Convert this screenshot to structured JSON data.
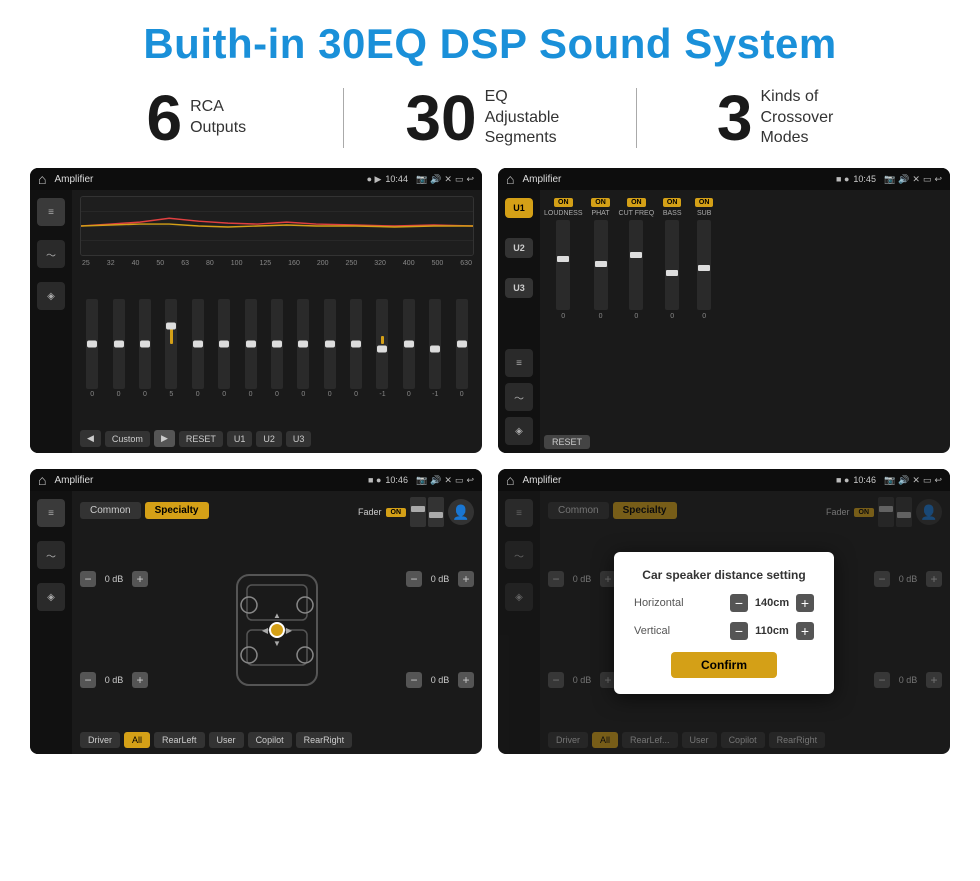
{
  "header": {
    "title": "Buith-in 30EQ DSP Sound System"
  },
  "stats": [
    {
      "number": "6",
      "text_line1": "RCA",
      "text_line2": "Outputs"
    },
    {
      "number": "30",
      "text_line1": "EQ Adjustable",
      "text_line2": "Segments"
    },
    {
      "number": "3",
      "text_line1": "Kinds of",
      "text_line2": "Crossover Modes"
    }
  ],
  "screen1": {
    "title": "Amplifier",
    "time": "10:44",
    "eq_labels": [
      "25",
      "32",
      "40",
      "50",
      "63",
      "80",
      "100",
      "125",
      "160",
      "200",
      "250",
      "320",
      "400",
      "500",
      "630"
    ],
    "eq_values": [
      "0",
      "0",
      "0",
      "5",
      "0",
      "0",
      "0",
      "0",
      "0",
      "0",
      "0",
      "-1",
      "0",
      "-1"
    ],
    "preset": "Custom",
    "buttons": [
      "◀",
      "Custom",
      "▶",
      "RESET",
      "U1",
      "U2",
      "U3"
    ]
  },
  "screen2": {
    "title": "Amplifier",
    "time": "10:45",
    "u_buttons": [
      "U1",
      "U2",
      "U3"
    ],
    "controls": [
      "LOUDNESS",
      "PHAT",
      "CUT FREQ",
      "BASS",
      "SUB"
    ],
    "reset": "RESET"
  },
  "screen3": {
    "title": "Amplifier",
    "time": "10:46",
    "tabs": [
      "Common",
      "Specialty"
    ],
    "fader_label": "Fader",
    "fader_on": "ON",
    "controls": [
      {
        "label": "Driver",
        "value": "0 dB"
      },
      {
        "label": "Copilot",
        "value": "0 dB"
      },
      {
        "label": "RearLeft",
        "value": "0 dB"
      },
      {
        "label": "RearRight",
        "value": "0 dB"
      }
    ],
    "buttons": [
      "Driver",
      "Copilot",
      "RearLeft",
      "All",
      "User",
      "RearRight"
    ]
  },
  "screen4": {
    "title": "Amplifier",
    "time": "10:46",
    "tabs": [
      "Common",
      "Specialty"
    ],
    "dialog": {
      "title": "Car speaker distance setting",
      "horizontal_label": "Horizontal",
      "horizontal_value": "140cm",
      "vertical_label": "Vertical",
      "vertical_value": "110cm",
      "confirm_label": "Confirm"
    },
    "controls": [
      {
        "label": "Driver",
        "value": "0 dB"
      },
      {
        "label": "Copilot",
        "value": "0 dB"
      }
    ],
    "buttons": [
      "Driver",
      "RearLef...",
      "All",
      "User",
      "Copilot",
      "RearRight"
    ]
  }
}
